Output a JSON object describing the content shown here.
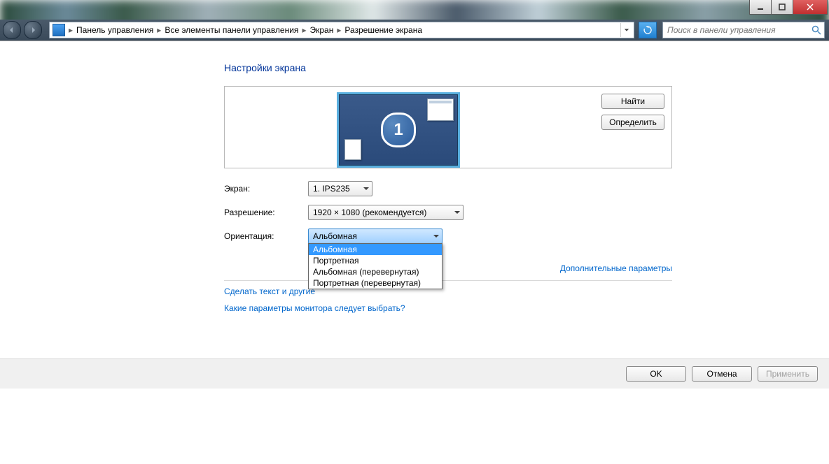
{
  "breadcrumbs": {
    "b1": "Панель управления",
    "b2": "Все элементы панели управления",
    "b3": "Экран",
    "b4": "Разрешение экрана"
  },
  "search": {
    "placeholder": "Поиск в панели управления"
  },
  "heading": "Настройки экрана",
  "monitor_number": "1",
  "buttons": {
    "find": "Найти",
    "detect": "Определить",
    "ok": "OK",
    "cancel": "Отмена",
    "apply": "Применить"
  },
  "fields": {
    "screen_label": "Экран:",
    "screen_value": "1. IPS235",
    "resolution_label": "Разрешение:",
    "resolution_value": "1920 × 1080 (рекомендуется)",
    "orientation_label": "Ориентация:",
    "orientation_value": "Альбомная"
  },
  "orientation_options": {
    "o1": "Альбомная",
    "o2": "Портретная",
    "o3": "Альбомная (перевернутая)",
    "o4": "Портретная (перевернутая)"
  },
  "links": {
    "advanced": "Дополнительные параметры",
    "text_size": "Сделать текст и другие",
    "which_monitor": "Какие параметры монитора следует выбрать?"
  }
}
